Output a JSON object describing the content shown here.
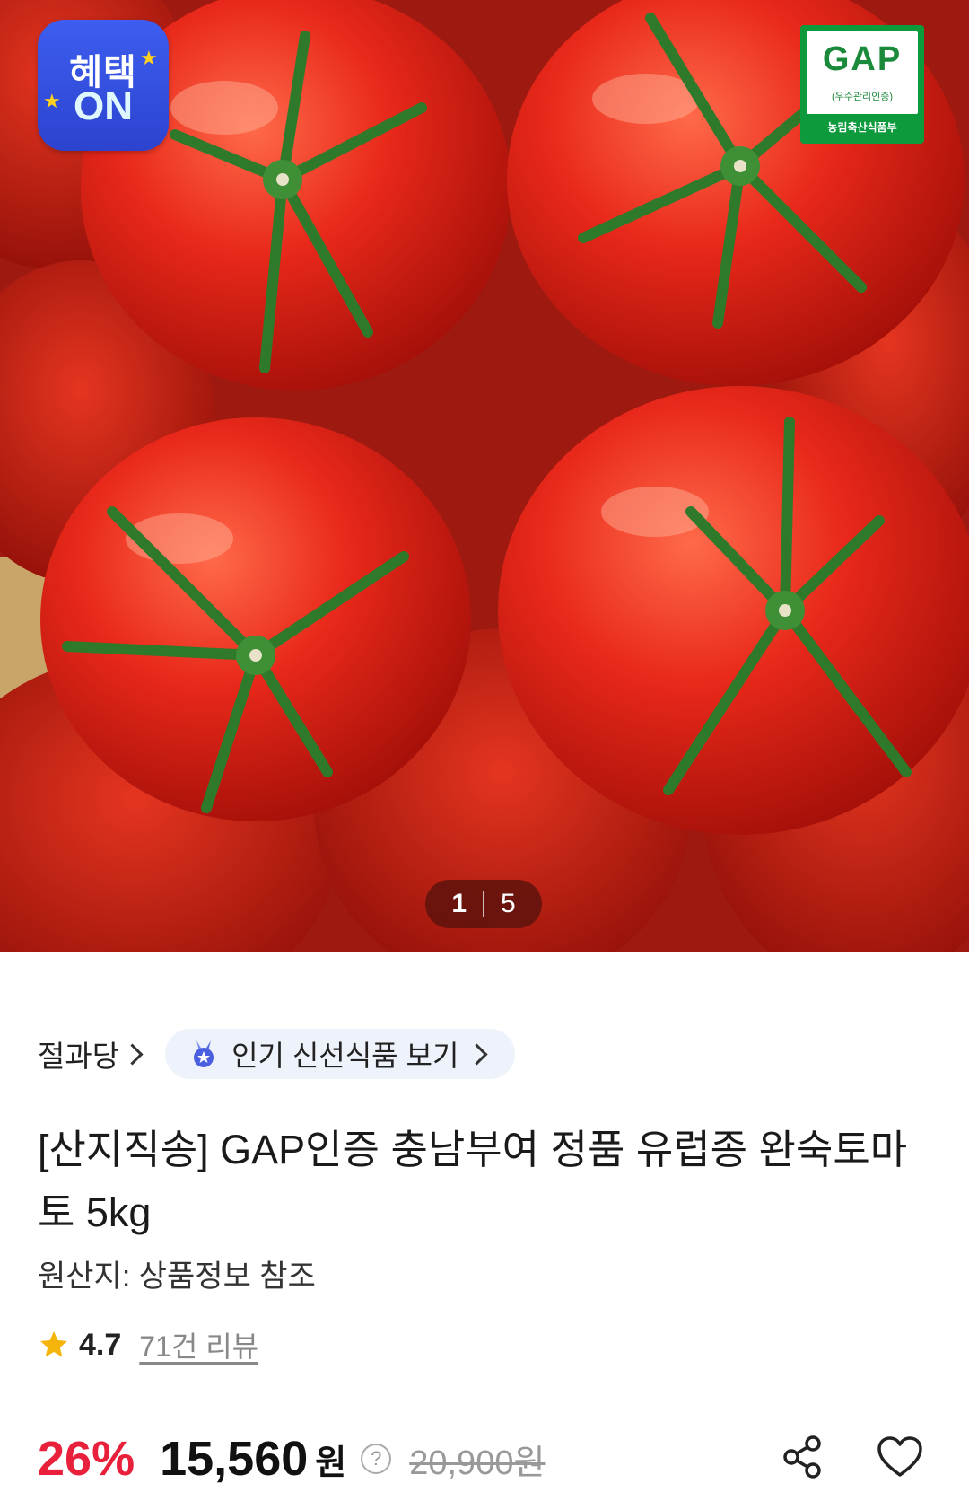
{
  "hero": {
    "benefit_badge": {
      "line1": "혜택",
      "line2": "ON"
    },
    "gap_badge": {
      "title": "GAP",
      "subtitle": "(우수관리인증)",
      "footer": "농림축산식품부"
    },
    "pager": {
      "current": "1",
      "total": "5"
    }
  },
  "brand": {
    "seller_name": "절과당",
    "promo_chip_label": "인기 신선식품 보기"
  },
  "product": {
    "title": "[산지직송] GAP인증 충남부여 정품 유럽종 완숙토마토 5kg",
    "origin": "원산지: 상품정보 참조",
    "rating": "4.7",
    "review_count": "71건 리뷰"
  },
  "price": {
    "discount": "26%",
    "sale_price": "15,560",
    "currency": "원",
    "help": "?",
    "original_price": "20,900원"
  },
  "colors": {
    "accent_discount": "#e8203c",
    "badge_blue": "#2c43cf",
    "gap_green": "#0c9a3c",
    "star": "#f5b40a"
  },
  "icons": [
    "star-icon",
    "help-icon",
    "share-icon",
    "heart-icon",
    "medal-icon",
    "chevron-right-icon"
  ]
}
